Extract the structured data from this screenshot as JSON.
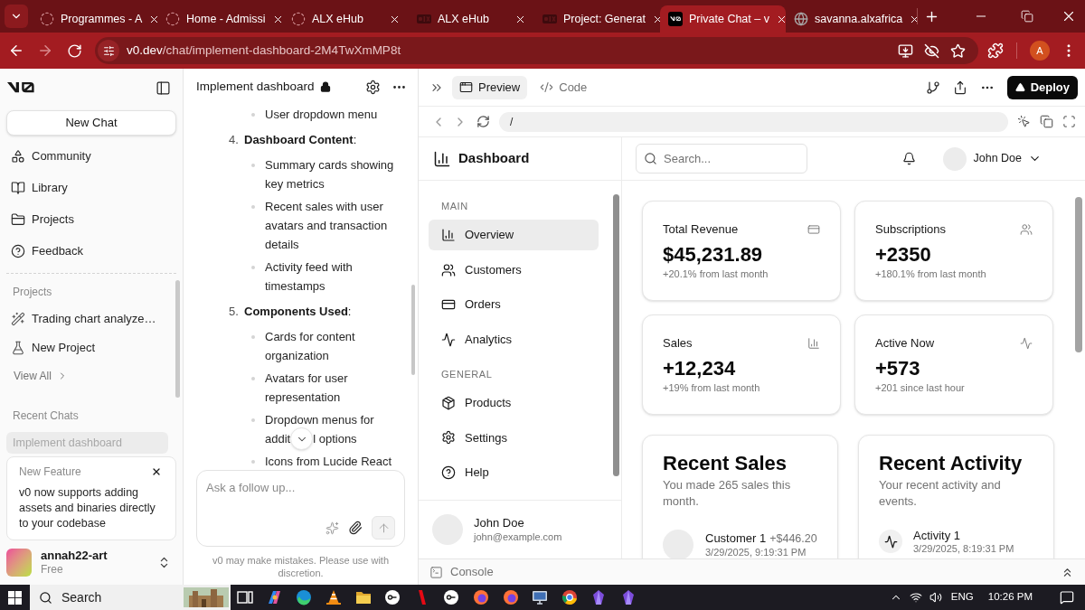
{
  "browser": {
    "tabs": [
      {
        "title": "Programmes - A",
        "selected": false
      },
      {
        "title": "Home - Admissi",
        "selected": false
      },
      {
        "title": "ALX eHub",
        "selected": false
      },
      {
        "title": "ALX eHub",
        "selected": false
      },
      {
        "title": "Project: Generat",
        "selected": false
      },
      {
        "title": "Private Chat – v",
        "selected": true
      },
      {
        "title": "savanna.alxafrica",
        "selected": false
      }
    ],
    "address": {
      "domain": "v0.dev",
      "path": "/chat/implement-dashboard-2M4TwXmMP8t"
    },
    "profile_initial": "A"
  },
  "sidebar": {
    "new_chat": "New Chat",
    "nav": [
      "Community",
      "Library",
      "Projects",
      "Feedback"
    ],
    "projects_heading": "Projects",
    "projects": [
      "Trading chart analyze…",
      "New Project"
    ],
    "view_all": "View All",
    "recent_heading": "Recent Chats",
    "recent_chats": [
      {
        "title": "Implement dashboard",
        "selected": true
      }
    ],
    "notice": {
      "title": "New Feature",
      "body": "v0 now supports adding assets and binaries directly to your codebase"
    },
    "account": {
      "name": "annah22-art",
      "plan": "Free"
    }
  },
  "chat": {
    "title": "Implement dashboard",
    "locked": true,
    "content": [
      {
        "kind": "bullet",
        "text": "User dropdown menu"
      },
      {
        "kind": "numbered",
        "number": "4.",
        "title": "**Dashboard Content**:",
        "items": [
          {
            "kind": "text",
            "text": "Summary cards showing key metrics"
          },
          {
            "kind": "text",
            "text": "Recent sales with user avatars and transaction details"
          },
          {
            "kind": "text",
            "text": "Activity feed with timestamps"
          }
        ]
      },
      {
        "kind": "numbered",
        "number": "5.",
        "title": "**Components Used**:",
        "items": [
          {
            "kind": "text",
            "text": "Cards for content organization"
          },
          {
            "kind": "text",
            "text": "Avatars for user representation"
          },
          {
            "kind": "split",
            "segments": [
              "Dropdown menus for",
              "addit",
              "l options"
            ]
          },
          {
            "kind": "text",
            "text": "Icons from Lucide React"
          }
        ]
      }
    ],
    "input": {
      "placeholder": "Ask a follow up...",
      "send_disabled": true
    },
    "disclaimer": "v0 may make mistakes. Please use with discretion."
  },
  "preview": {
    "tabs": [
      {
        "label": "Preview",
        "selected": true
      },
      {
        "label": "Code",
        "selected": false
      }
    ],
    "deploy": "Deploy",
    "path": "/",
    "app": {
      "title": "Dashboard",
      "sections": [
        {
          "heading": "MAIN",
          "items": [
            {
              "label": "Overview",
              "selected": true
            },
            {
              "label": "Customers",
              "selected": false
            },
            {
              "label": "Orders",
              "selected": false
            },
            {
              "label": "Analytics",
              "selected": false
            }
          ]
        },
        {
          "heading": "GENERAL",
          "items": [
            {
              "label": "Products",
              "selected": false
            },
            {
              "label": "Settings",
              "selected": false
            },
            {
              "label": "Help",
              "selected": false
            }
          ]
        }
      ],
      "user": {
        "name": "John Doe",
        "email": "john@example.com"
      },
      "search": {
        "placeholder": "Search..."
      },
      "account_name": "John Doe",
      "stats": [
        {
          "title": "Total Revenue",
          "value": "$45,231.89",
          "change": "+20.1% from last month"
        },
        {
          "title": "Subscriptions",
          "value": "+2350",
          "change": "+180.1% from last month"
        },
        {
          "title": "Sales",
          "value": "+12,234",
          "change": "+19% from last month"
        },
        {
          "title": "Active Now",
          "value": "+573",
          "change": "+201 since last hour"
        }
      ],
      "recent_sales": {
        "title": "Recent Sales",
        "subtitle": "You made 265 sales this month.",
        "rows": [
          {
            "name": "Customer 1",
            "amount": "+$446.20",
            "time": "3/29/2025, 9:19:31 PM"
          }
        ]
      },
      "recent_activity": {
        "title": "Recent Activity",
        "subtitle": "Your recent activity and events.",
        "rows": [
          {
            "name": "Activity 1",
            "time": "3/29/2025, 8:19:31 PM"
          }
        ]
      }
    },
    "console": "Console"
  },
  "taskbar": {
    "search": "Search",
    "language": "ENG",
    "time": "10:26 PM"
  }
}
